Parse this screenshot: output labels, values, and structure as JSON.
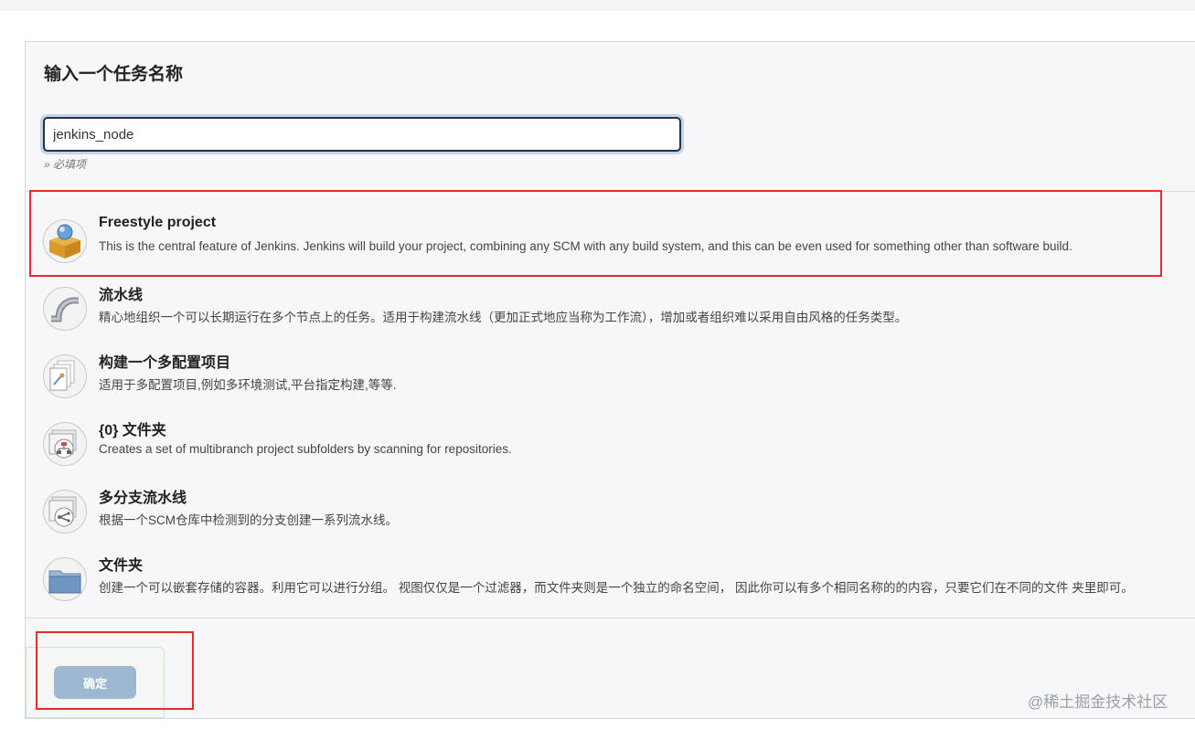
{
  "page": {
    "title": "输入一个任务名称",
    "job_name": "jenkins_node",
    "required_hint": "» 必填项"
  },
  "item_types": [
    {
      "icon": "freestyle-box-icon",
      "title": "Freestyle project",
      "description": "This is the central feature of Jenkins. Jenkins will build your project, combining any SCM with any build system, and this can be even used for something other than software build."
    },
    {
      "icon": "pipeline-icon",
      "title": "流水线",
      "description": "精心地组织一个可以长期运行在多个节点上的任务。适用于构建流水线（更加正式地应当称为工作流），增加或者组织难以采用自由风格的任务类型。"
    },
    {
      "icon": "multi-config-icon",
      "title": "构建一个多配置项目",
      "description": "适用于多配置项目,例如多环境测试,平台指定构建,等等."
    },
    {
      "icon": "org-folder-icon",
      "title": "{0} 文件夹",
      "description": "Creates a set of multibranch project subfolders by scanning for repositories."
    },
    {
      "icon": "multibranch-icon",
      "title": "多分支流水线",
      "description": "根据一个SCM仓库中检测到的分支创建一系列流水线。"
    },
    {
      "icon": "folder-icon",
      "title": "文件夹",
      "description": "创建一个可以嵌套存储的容器。利用它可以进行分组。 视图仅仅是一个过滤器，而文件夹则是一个独立的命名空间， 因此你可以有多个相同名称的的内容，只要它们在不同的文件 夹里即可。"
    }
  ],
  "footer": {
    "ok_label": "确定"
  },
  "watermark": "@稀土掘金技术社区",
  "colors": {
    "highlight": "#e52b2b",
    "ok_button": "#9fb8d1",
    "input_border": "#21334a"
  }
}
